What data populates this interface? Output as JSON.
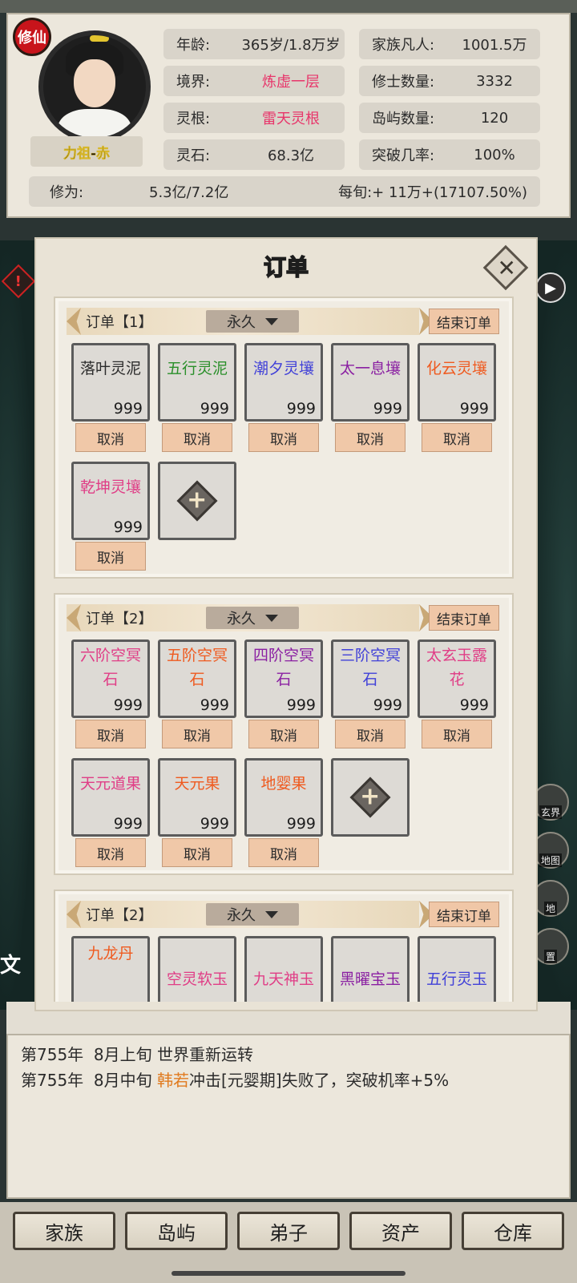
{
  "header": {
    "badge": "修仙",
    "player_name": "力祖-赤",
    "stats": [
      {
        "label": "年龄:",
        "value": "365岁/1.8万岁"
      },
      {
        "label": "家族凡人:",
        "value": "1001.5万"
      },
      {
        "label": "境界:",
        "value": "炼虚一层"
      },
      {
        "label": "修士数量:",
        "value": "3332"
      },
      {
        "label": "灵根:",
        "value": "雷天灵根"
      },
      {
        "label": "岛屿数量:",
        "value": "120"
      },
      {
        "label": "灵石:",
        "value": "68.3亿"
      },
      {
        "label": "突破几率:",
        "value": "100%"
      }
    ],
    "cultivation_label": "修为:",
    "cultivation_value": "5.3亿/7.2亿",
    "per_period": "每旬:+ 11万+(17107.50%)"
  },
  "modal": {
    "title": "订单",
    "close_icon": "close-icon",
    "orders": [
      {
        "label": "订单【1】",
        "duration": "永久",
        "end_label": "结束订单",
        "items": [
          {
            "name": "落叶灵泥",
            "qty": "999",
            "color": "#2b2b2b"
          },
          {
            "name": "五行灵泥",
            "qty": "999",
            "color": "#2a8f2a"
          },
          {
            "name": "潮夕灵壤",
            "qty": "999",
            "color": "#4040d8"
          },
          {
            "name": "太一息壤",
            "qty": "999",
            "color": "#8a1fa2"
          },
          {
            "name": "化云灵壤",
            "qty": "999",
            "color": "#ef5a1f"
          },
          {
            "name": "乾坤灵壤",
            "qty": "999",
            "color": "#e03d86"
          }
        ]
      },
      {
        "label": "订单【2】",
        "duration": "永久",
        "end_label": "结束订单",
        "items": [
          {
            "name": "六阶空冥石",
            "qty": "999",
            "color": "#e03d86"
          },
          {
            "name": "五阶空冥石",
            "qty": "999",
            "color": "#ef5a1f"
          },
          {
            "name": "四阶空冥石",
            "qty": "999",
            "color": "#8a1fa2"
          },
          {
            "name": "三阶空冥石",
            "qty": "999",
            "color": "#4040d8"
          },
          {
            "name": "太玄玉露花",
            "qty": "999",
            "color": "#e03d86"
          },
          {
            "name": "天元道果",
            "qty": "999",
            "color": "#e03d86"
          },
          {
            "name": "天元果",
            "qty": "999",
            "color": "#ef5a1f"
          },
          {
            "name": "地婴果",
            "qty": "999",
            "color": "#ef5a1f"
          }
        ]
      },
      {
        "label": "订单【2】",
        "duration": "永久",
        "end_label": "结束订单",
        "items": [
          {
            "name": "九龙丹",
            "color": "#ef5a1f"
          },
          {
            "name": "空灵软玉",
            "color": "#e03d86"
          },
          {
            "name": "九天神玉",
            "color": "#e03d86"
          },
          {
            "name": "黑曜宝玉",
            "color": "#8a1fa2"
          },
          {
            "name": "五行灵玉",
            "color": "#4040d8"
          }
        ]
      }
    ],
    "cancel_label": "取消"
  },
  "log": {
    "lines": [
      {
        "date": "第755年",
        "period": "8月上旬",
        "pre": "世界重新运转",
        "name": "",
        "post": ""
      },
      {
        "date": "第755年",
        "period": "8月中旬",
        "pre": "",
        "name": "韩若",
        "post": "冲击[元婴期]失败了，突破机率+5%"
      }
    ],
    "highlight_color": "#e07a1e"
  },
  "side": {
    "warning_icon": "!",
    "play_icon": "▶",
    "left_text": "文",
    "right_items": [
      "玄界",
      "地图",
      "地",
      "置"
    ]
  },
  "nav": [
    "家族",
    "岛屿",
    "弟子",
    "资产",
    "仓库"
  ]
}
